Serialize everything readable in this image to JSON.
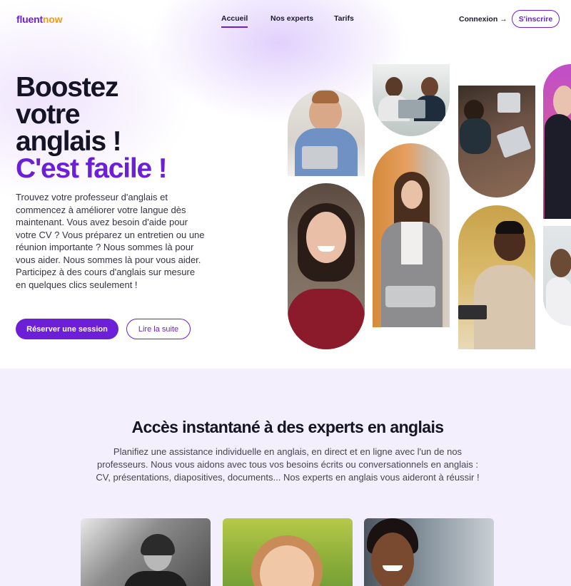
{
  "brand": {
    "logo_part1": "fluent",
    "logo_part2": "now",
    "primary_color": "#6d1fd8",
    "logo_accent_color": "#f39c12"
  },
  "nav": {
    "links": [
      {
        "label": "Accueil",
        "active": true
      },
      {
        "label": "Nos experts",
        "active": false
      },
      {
        "label": "Tarifs",
        "active": false
      }
    ],
    "login_label": "Connexion →",
    "signup_label": "S'inscrire"
  },
  "hero": {
    "headline_lines": [
      "Boostez",
      "votre",
      "anglais !"
    ],
    "headline_accent": "C'est facile !",
    "paragraph": "Trouvez votre professeur d'anglais et commencez à améliorer votre langue dès maintenant. Vous avez besoin d'aide pour votre CV ? Vous préparez un entretien ou une réunion importante ? Nous sommes là pour vous aider. Nous sommes là pour vous aider. Participez à des cours d'anglais sur mesure en quelques clics seulement !",
    "primary_button": "Réserver une session",
    "secondary_button": "Lire la suite"
  },
  "experts_section": {
    "title": "Accès instantané à des experts en anglais",
    "description": "Planifiez une assistance individuelle en anglais, en direct et en ligne avec l'un de nos professeurs. Nous vous aidons avec tous vos besoins écrits ou conversationnels en anglais : CV, présentations, diapositives, documents... Nos experts en anglais vous aideront à réussir !"
  }
}
